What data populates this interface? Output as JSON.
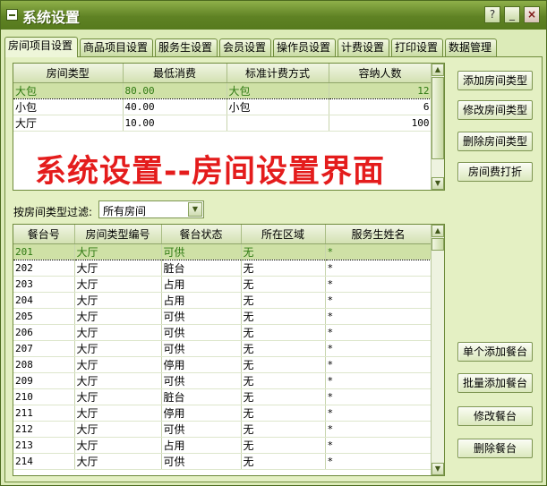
{
  "window": {
    "title": "系统设置"
  },
  "titlebar_buttons": {
    "help": "?",
    "minimize": "_",
    "close": "×"
  },
  "tabs": [
    {
      "label": "房间项目设置",
      "active": true
    },
    {
      "label": "商品项目设置"
    },
    {
      "label": "服务生设置"
    },
    {
      "label": "会员设置"
    },
    {
      "label": "操作员设置"
    },
    {
      "label": "计费设置"
    },
    {
      "label": "打印设置"
    },
    {
      "label": "数据管理"
    }
  ],
  "room_types": {
    "columns": [
      "房间类型",
      "最低消费",
      "标准计费方式",
      "容纳人数"
    ],
    "rows": [
      {
        "type": "大包",
        "min_spend": "80.00",
        "billing": "大包",
        "capacity": "12"
      },
      {
        "type": "小包",
        "min_spend": "40.00",
        "billing": "小包",
        "capacity": "6"
      },
      {
        "type": "大厅",
        "min_spend": "10.00",
        "billing": "",
        "capacity": "100"
      }
    ]
  },
  "room_type_buttons": {
    "add": "添加房间类型",
    "edit": "修改房间类型",
    "delete": "删除房间类型",
    "discount": "房间费打折"
  },
  "overlay_caption": "系统设置--房间设置界面",
  "filter": {
    "label": "按房间类型过滤:",
    "value": "所有房间"
  },
  "tables": {
    "columns": [
      "餐台号",
      "房间类型编号",
      "餐台状态",
      "所在区域",
      "服务生姓名"
    ],
    "rows": [
      {
        "no": "201",
        "type": "大厅",
        "status": "可供",
        "area": "无",
        "waiter": "*"
      },
      {
        "no": "202",
        "type": "大厅",
        "status": "脏台",
        "area": "无",
        "waiter": "*"
      },
      {
        "no": "203",
        "type": "大厅",
        "status": "占用",
        "area": "无",
        "waiter": "*"
      },
      {
        "no": "204",
        "type": "大厅",
        "status": "占用",
        "area": "无",
        "waiter": "*"
      },
      {
        "no": "205",
        "type": "大厅",
        "status": "可供",
        "area": "无",
        "waiter": "*"
      },
      {
        "no": "206",
        "type": "大厅",
        "status": "可供",
        "area": "无",
        "waiter": "*"
      },
      {
        "no": "207",
        "type": "大厅",
        "status": "可供",
        "area": "无",
        "waiter": "*"
      },
      {
        "no": "208",
        "type": "大厅",
        "status": "停用",
        "area": "无",
        "waiter": "*"
      },
      {
        "no": "209",
        "type": "大厅",
        "status": "可供",
        "area": "无",
        "waiter": "*"
      },
      {
        "no": "210",
        "type": "大厅",
        "status": "脏台",
        "area": "无",
        "waiter": "*"
      },
      {
        "no": "211",
        "type": "大厅",
        "status": "停用",
        "area": "无",
        "waiter": "*"
      },
      {
        "no": "212",
        "type": "大厅",
        "status": "可供",
        "area": "无",
        "waiter": "*"
      },
      {
        "no": "213",
        "type": "大厅",
        "status": "占用",
        "area": "无",
        "waiter": "*"
      },
      {
        "no": "214",
        "type": "大厅",
        "status": "可供",
        "area": "无",
        "waiter": "*"
      }
    ]
  },
  "table_buttons": {
    "add_single": "单个添加餐台",
    "add_batch": "批量添加餐台",
    "edit": "修改餐台",
    "delete": "删除餐台"
  },
  "scroll_icons": {
    "up": "▲",
    "down": "▼"
  },
  "colors": {
    "titlebar": "#5f8224",
    "panel": "#e4f0c3",
    "selected_row": "#cfe1a6",
    "overlay_text": "#e41c1c"
  }
}
